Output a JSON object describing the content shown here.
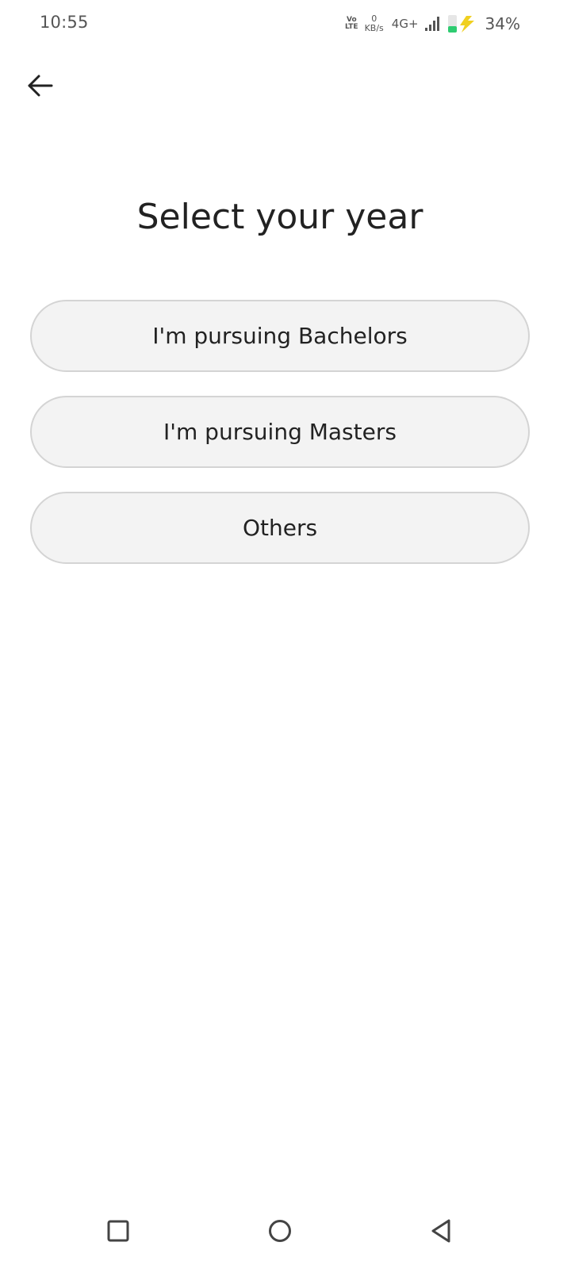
{
  "status_bar": {
    "time": "10:55",
    "volte_top": "Vo",
    "volte_bottom": "LTE",
    "net_speed_value": "0",
    "net_speed_unit": "KB/s",
    "network_type": "4G+",
    "battery_percent": "34%",
    "battery_level": 0.34,
    "icons": [
      "volte-icon",
      "signal-icon",
      "battery-charging-icon"
    ]
  },
  "header": {
    "back_icon": "arrow-left-icon"
  },
  "main": {
    "title": "Select your year",
    "options": [
      {
        "label": "I'm pursuing Bachelors"
      },
      {
        "label": "I'm pursuing Masters"
      },
      {
        "label": "Others"
      }
    ]
  },
  "nav_bar": {
    "icons": [
      "recent-apps-icon",
      "home-icon",
      "back-nav-icon"
    ]
  },
  "colors": {
    "option_bg": "#f3f3f3",
    "option_border": "#d4d4d4",
    "text": "#222222",
    "status_text": "#555555",
    "battery_green": "#2ecc71",
    "charge_yellow": "#f0d020"
  }
}
